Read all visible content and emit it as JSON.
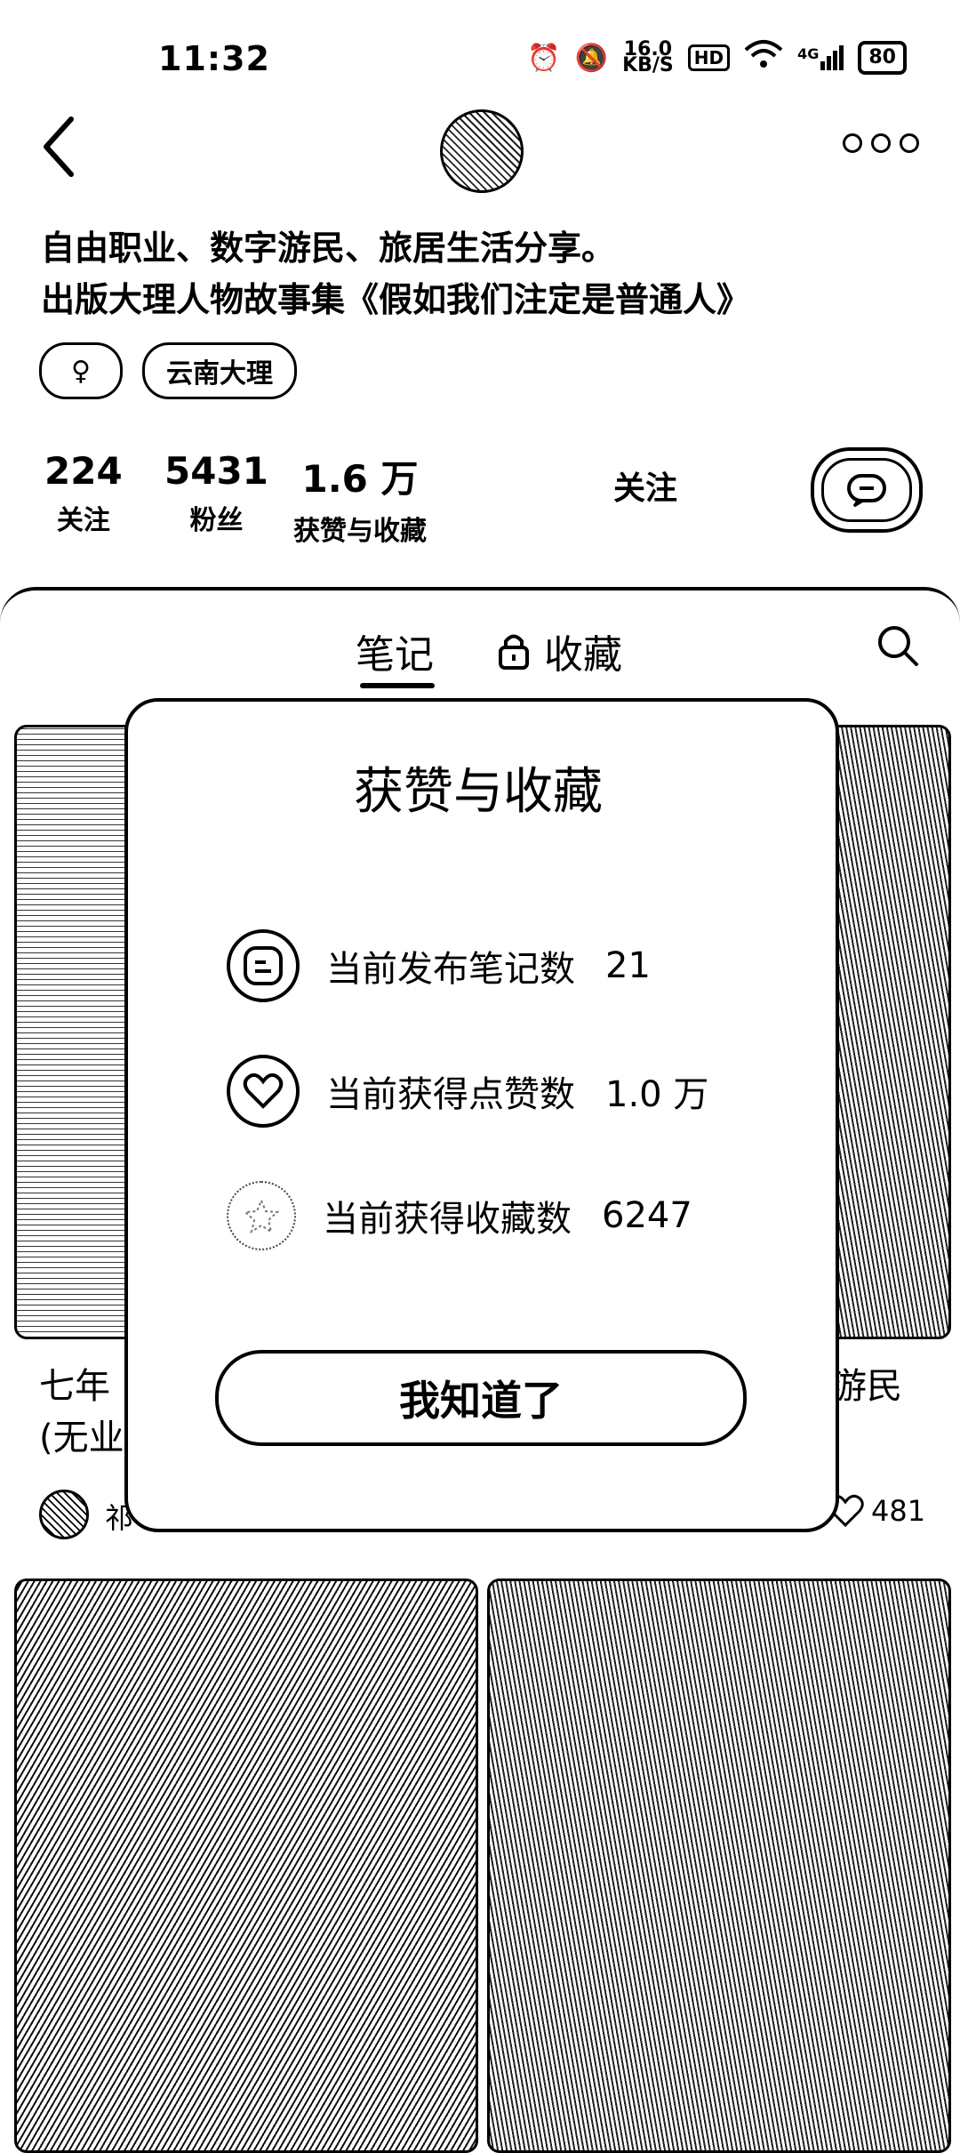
{
  "status_bar": {
    "time": "11:32",
    "net_speed": "16.0",
    "net_unit": "KB/S",
    "hd": "HD",
    "signal": "4G",
    "battery": "80"
  },
  "profile": {
    "bio_line1": "自由职业、数字游民、旅居生活分享。",
    "bio_line2": "出版大理人物故事集《假如我们注定是普通人》",
    "tags": [
      "♀",
      "云南大理"
    ],
    "stats": [
      {
        "value": "224",
        "label": "关注"
      },
      {
        "value": "5431",
        "label": "粉丝"
      },
      {
        "value": "1.6 万",
        "label": "获赞与收藏"
      }
    ],
    "follow_label": "关注"
  },
  "tabs": {
    "notes": "笔记",
    "collect": "收藏"
  },
  "feed": {
    "card1_title": "七年",
    "card1_title_line2": "(无业",
    "card1_author": "祁",
    "card2_title": "游民",
    "card2_likes": "481"
  },
  "modal": {
    "title": "获赞与收藏",
    "rows": [
      {
        "label": "当前发布笔记数",
        "value": "21",
        "icon": "note-icon"
      },
      {
        "label": "当前获得点赞数",
        "value": "1.0 万",
        "icon": "heart-icon"
      },
      {
        "label": "当前获得收藏数",
        "value": "6247",
        "icon": "star-icon"
      }
    ],
    "confirm": "我知道了"
  }
}
